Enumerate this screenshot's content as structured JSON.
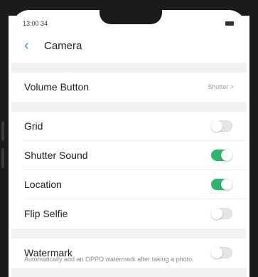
{
  "status_bar": {
    "time": "13:00 34"
  },
  "header": {
    "back_icon": "chevron-left-icon",
    "title": "Camera"
  },
  "settings": {
    "volume_button": {
      "label": "Volume Button",
      "value": "Shutter >"
    },
    "grid": {
      "label": "Grid",
      "state": "off"
    },
    "shutter_sound": {
      "label": "Shutter Sound",
      "state": "on"
    },
    "location": {
      "label": "Location",
      "state": "on"
    },
    "flip_selfie": {
      "label": "Flip Selfie",
      "state": "off"
    },
    "watermark": {
      "label": "Watermark",
      "state": "off"
    }
  },
  "footnote": "Automatically add an OPPO watermark after taking a photo.",
  "colors": {
    "accent": "#2fb56c",
    "background": "#f2f2f2",
    "bezel": "#1b1b1b"
  }
}
